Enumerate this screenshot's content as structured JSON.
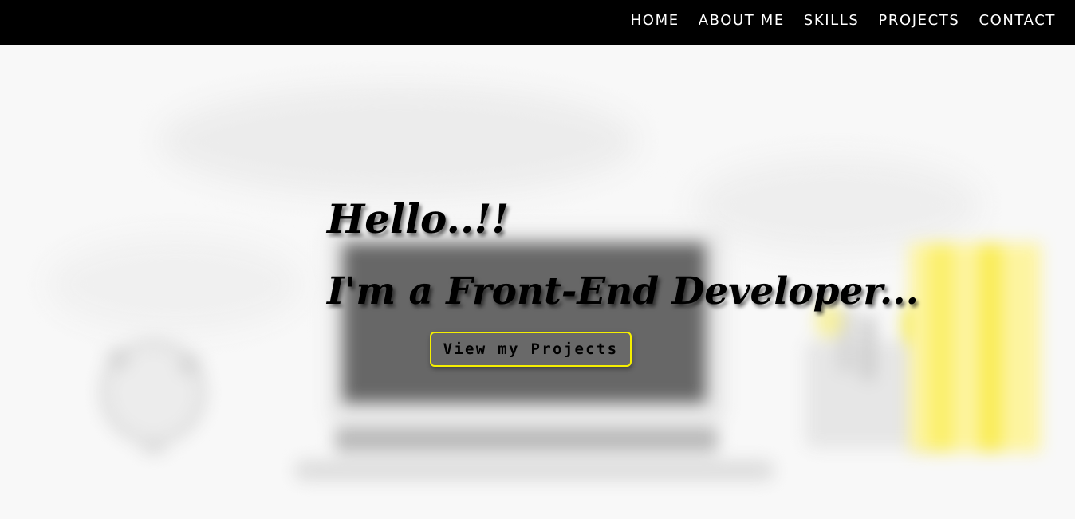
{
  "nav": {
    "items": [
      {
        "label": "HOME"
      },
      {
        "label": "ABOUT ME"
      },
      {
        "label": "SKILLS"
      },
      {
        "label": "PROJECTS"
      },
      {
        "label": "CONTACT"
      }
    ]
  },
  "hero": {
    "greeting": "Hello..!!",
    "tagline": "I'm a Front-End Developer...",
    "cta_label": "View my Projects",
    "background_image": "blurred-desk-with-laptop-clock-and-yellow-books"
  },
  "colors": {
    "navbar_background": "#000000",
    "nav_text": "#ffffff",
    "hero_text": "#000000",
    "cta_border": "#f5ef00",
    "accent_yellow": "#fdf27a"
  }
}
